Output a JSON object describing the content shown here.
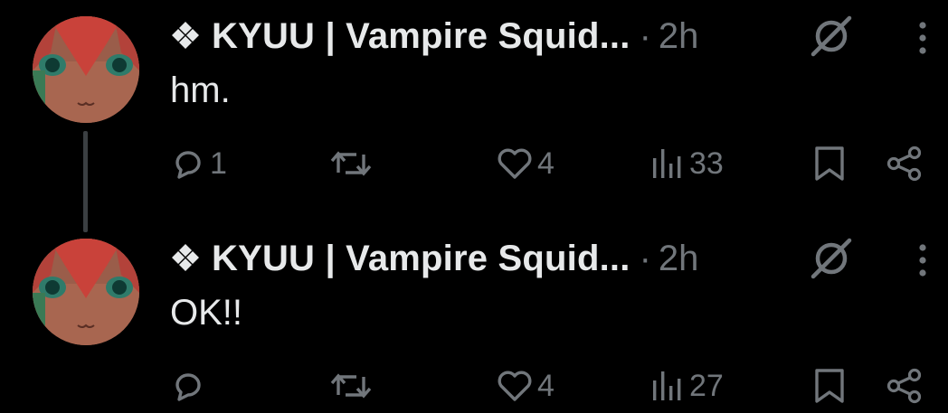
{
  "thread": {
    "tweets": [
      {
        "author": "KYUU | Vampire Squid...",
        "separator": "·",
        "time": "2h",
        "text": "hm.",
        "stats": {
          "replies": "1",
          "reposts": "",
          "likes": "4",
          "views": "33"
        }
      },
      {
        "author": "KYUU | Vampire Squid...",
        "separator": "·",
        "time": "2h",
        "text": "OK!!",
        "stats": {
          "replies": "",
          "reposts": "",
          "likes": "4",
          "views": "27"
        }
      }
    ]
  },
  "icons": {
    "name_prefix": "diamond-icon",
    "grok": "grok-slash-icon",
    "more": "vertical-dots-icon",
    "reply": "reply-icon",
    "repost": "repost-icon",
    "like": "heart-icon",
    "views": "bar-chart-icon",
    "bookmark": "bookmark-icon",
    "share": "share-icon"
  },
  "colors": {
    "background": "#000000",
    "text": "#e7e9ea",
    "muted": "#71767b"
  }
}
